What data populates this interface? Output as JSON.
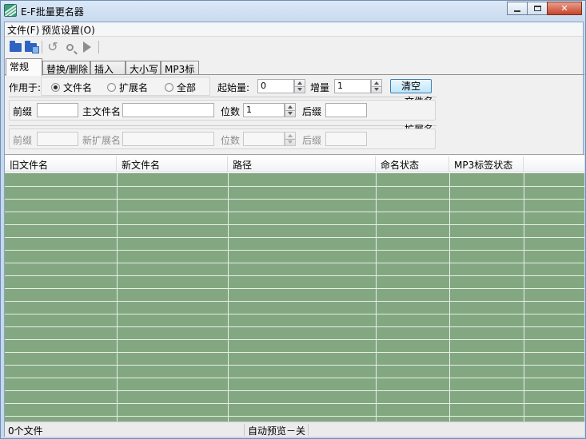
{
  "window": {
    "title": "E-F批量更名器"
  },
  "menu": {
    "items": [
      "文件(F)",
      "预览设置(O)"
    ]
  },
  "toolbar": {
    "icons": [
      "open-folder-icon",
      "save-folder-icon",
      "undo-icon",
      "preview-icon",
      "run-icon"
    ]
  },
  "tabs": [
    "常规",
    "替换/删除",
    "插入",
    "大小写",
    "MP3标签"
  ],
  "general": {
    "apply_to_label": "作用于:",
    "radios": {
      "filename": "文件名",
      "extension": "扩展名",
      "all": "全部"
    },
    "selected_radio": "文件名",
    "start_label": "起始量:",
    "start_value": "0",
    "step_label": "增量",
    "step_value": "1",
    "clear_label": "清空"
  },
  "filename_group": {
    "title": "文件名",
    "prefix_label": "前缀",
    "prefix_value": "",
    "main_label": "主文件名",
    "main_value": "",
    "digits_label": "位数",
    "digits_value": "1",
    "suffix_label": "后缀",
    "suffix_value": ""
  },
  "extension_group": {
    "title": "扩展名",
    "prefix_label": "前缀",
    "prefix_value": "",
    "new_ext_label": "新扩展名",
    "new_ext_value": "",
    "digits_label": "位数",
    "digits_value": "",
    "suffix_label": "后缀",
    "suffix_value": ""
  },
  "list": {
    "columns": [
      "旧文件名",
      "新文件名",
      "路径",
      "命名状态",
      "MP3标签状态"
    ],
    "rows": []
  },
  "status": {
    "file_count": "0个文件",
    "auto_preview": "自动预览－关"
  },
  "colors": {
    "list_background": "#83a881",
    "window_frame": "#c9dcef",
    "close_button": "#c6452a"
  }
}
